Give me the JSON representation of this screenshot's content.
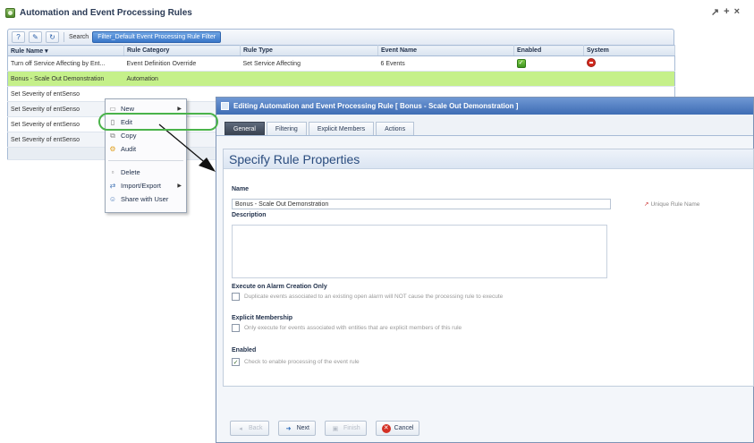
{
  "portlet": {
    "title": "Automation and Event Processing Rules",
    "controls": [
      "↗",
      "+",
      "×"
    ]
  },
  "toolbar": {
    "search_label": "Search",
    "filter_label": "Filter_Default Event Processing Rule Filter"
  },
  "table": {
    "columns": [
      "Rule Name ▾",
      "Rule Category",
      "Rule Type",
      "Event Name",
      "Enabled",
      "System"
    ],
    "rows": [
      {
        "name": "Turn off Service Affecting by Ent...",
        "category": "Event Definition Override",
        "type": "Set Service Affecting",
        "event": "6 Events"
      },
      {
        "name": "Bonus - Scale Out Demonstration",
        "category": "Automation",
        "type": "",
        "event": ""
      },
      {
        "name": "Set Severity of entSenso",
        "category": "",
        "type": "",
        "event": ""
      },
      {
        "name": "Set Severity of entSenso",
        "category": "",
        "type": "",
        "event": ""
      },
      {
        "name": "Set Severity of entSenso",
        "category": "",
        "type": "",
        "event": ""
      },
      {
        "name": "Set Severity of entSenso",
        "category": "",
        "type": "",
        "event": ""
      }
    ]
  },
  "context_menu": {
    "items": [
      {
        "label": "New",
        "icon": "new-icon",
        "submenu": true
      },
      {
        "label": "Edit",
        "icon": "edit-icon",
        "submenu": false
      },
      {
        "label": "Copy",
        "icon": "copy-icon",
        "submenu": false
      },
      {
        "label": "Audit",
        "icon": "audit-icon",
        "submenu": false
      },
      {
        "label": "Delete",
        "icon": "delete-icon",
        "submenu": false
      },
      {
        "label": "Import/Export",
        "icon": "import-export-icon",
        "submenu": true
      },
      {
        "label": "Share with User",
        "icon": "share-icon",
        "submenu": false
      }
    ]
  },
  "dialog": {
    "title": "Editing Automation and Event Processing Rule [ Bonus - Scale Out Demonstration ]",
    "tabs": [
      "General",
      "Filtering",
      "Explicit Members",
      "Actions"
    ],
    "section_title": "Specify Rule Properties",
    "name_label": "Name",
    "name_value": "Bonus - Scale Out Demonstration",
    "unique_note": "Unique Rule Name",
    "description_label": "Description",
    "execute_label": "Execute on Alarm Creation Only",
    "execute_text": "Duplicate events associated to an existing open alarm will NOT cause the processing rule to execute",
    "explicit_label": "Explicit Membership",
    "explicit_text": "Only execute for events associated with entities that are explicit members of this rule",
    "enabled_label": "Enabled",
    "enabled_text": "Check to enable processing of the event rule",
    "buttons": {
      "back": "Back",
      "next": "Next",
      "finish": "Finish",
      "cancel": "Cancel"
    }
  },
  "colors": {
    "selected_row": "#c5f08a",
    "accent": "#3e6cb4",
    "highlight_ring": "#4ab34a",
    "cancel": "#d33024"
  }
}
